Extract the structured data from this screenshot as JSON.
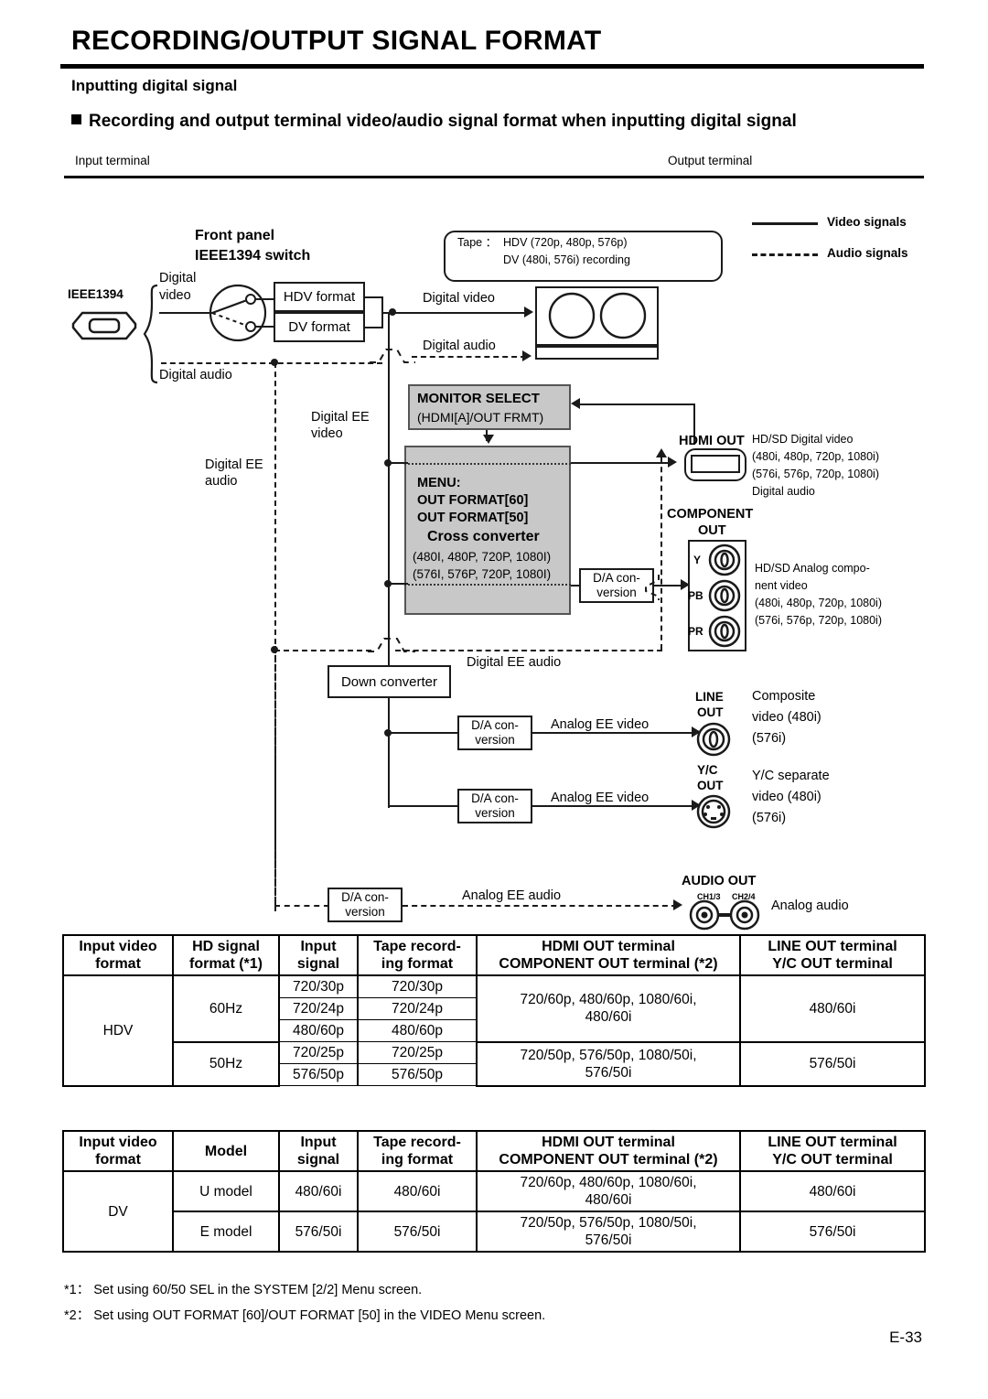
{
  "header": {
    "title": "RECORDING/OUTPUT SIGNAL FORMAT",
    "subtitle": "Inputting digital signal",
    "bullet_heading": "Recording and output terminal video/audio signal format when inputting digital signal",
    "input_terminal_label": "Input terminal",
    "output_terminal_label": "Output terminal"
  },
  "legend": {
    "video": "Video signals",
    "audio": "Audio signals"
  },
  "diagram": {
    "ieee1394_label": "IEEE1394",
    "front_panel_line1": "Front panel",
    "front_panel_line2": "IEEE1394 switch",
    "digital_video": "Digital",
    "digital_video2": "video",
    "digital_audio_in": "Digital audio",
    "hdv_format_box": "HDV format",
    "dv_format_box": "DV format",
    "tape_line1": "Tape ：  HDV (720p, 480p, 576p)",
    "tape_line2": "DV (480i, 576i) recording",
    "digital_video_to_vcr": "Digital video",
    "digital_audio_to_vcr": "Digital audio",
    "digital_ee_video": "Digital EE",
    "digital_ee_video2": "video",
    "digital_ee_audio": "Digital EE",
    "digital_ee_audio2": "audio",
    "monitor_select_line1": "MONITOR SELECT",
    "monitor_select_line2": "(HDMI[A]/OUT FRMT)",
    "menu_line1": "MENU:",
    "menu_line2": "OUT FORMAT[60]",
    "menu_line3": "OUT FORMAT[50]",
    "cross_converter": "Cross converter",
    "cross_line1": "(480I, 480P, 720P, 1080I)",
    "cross_line2": "(576I, 576P, 720P, 1080I)",
    "da_conversion_1": "D/A con-",
    "da_conversion_2": "version",
    "down_converter": "Down converter",
    "digital_ee_audio_mid": "Digital EE audio",
    "analog_ee_video_1": "Analog EE video",
    "analog_ee_video_2": "Analog EE video",
    "analog_ee_audio": "Analog EE audio"
  },
  "terminals": {
    "hdmi_out": "HDMI OUT",
    "hdmi_desc": [
      "HD/SD Digital video",
      "(480i, 480p, 720p, 1080i)",
      "(576i, 576p, 720p, 1080i)",
      "Digital audio"
    ],
    "component_out_line1": "COMPONENT",
    "component_out_line2": "OUT",
    "component_pins": [
      "Y",
      "PB",
      "PR"
    ],
    "component_desc": [
      "HD/SD Analog compo-",
      "nent video",
      "(480i, 480p, 720p, 1080i)",
      "(576i, 576p, 720p, 1080i)"
    ],
    "line_out_line1": "LINE",
    "line_out_line2": "OUT",
    "line_desc": [
      "Composite",
      "video (480i)",
      "(576i)"
    ],
    "yc_out_line1": "Y/C",
    "yc_out_line2": "OUT",
    "yc_desc": [
      "Y/C separate",
      "video (480i)",
      "(576i)"
    ],
    "audio_out": "AUDIO OUT",
    "audio_ch1": "CH1/3",
    "audio_ch2": "CH2/4",
    "audio_desc": "Analog audio"
  },
  "table_hdv": {
    "headers": [
      [
        "Input video",
        "format"
      ],
      [
        "HD signal",
        "format (*1)"
      ],
      [
        "Input",
        "signal"
      ],
      [
        "Tape record-",
        "ing format"
      ],
      [
        "HDMI OUT terminal",
        "COMPONENT OUT terminal (*2)"
      ],
      [
        "LINE OUT terminal",
        "Y/C OUT terminal"
      ]
    ],
    "format": "HDV",
    "groups": [
      {
        "hd_signal": "60Hz",
        "rows": [
          {
            "input": "720/30p",
            "tape": "720/30p"
          },
          {
            "input": "720/24p",
            "tape": "720/24p"
          },
          {
            "input": "480/60p",
            "tape": "480/60p"
          }
        ],
        "hdmi": [
          "720/60p, 480/60p, 1080/60i,",
          "480/60i"
        ],
        "line": "480/60i"
      },
      {
        "hd_signal": "50Hz",
        "rows": [
          {
            "input": "720/25p",
            "tape": "720/25p"
          },
          {
            "input": "576/50p",
            "tape": "576/50p"
          }
        ],
        "hdmi": [
          "720/50p, 576/50p, 1080/50i,",
          "576/50i"
        ],
        "line": "576/50i"
      }
    ]
  },
  "table_dv": {
    "headers": [
      [
        "Input video",
        "format"
      ],
      [
        "Model"
      ],
      [
        "Input",
        "signal"
      ],
      [
        "Tape record-",
        "ing format"
      ],
      [
        "HDMI OUT terminal",
        "COMPONENT OUT terminal (*2)"
      ],
      [
        "LINE OUT terminal",
        "Y/C OUT terminal"
      ]
    ],
    "format": "DV",
    "rows": [
      {
        "model": "U model",
        "input": "480/60i",
        "tape": "480/60i",
        "hdmi": [
          "720/60p, 480/60p, 1080/60i,",
          "480/60i"
        ],
        "line": "480/60i"
      },
      {
        "model": "E model",
        "input": "576/50i",
        "tape": "576/50i",
        "hdmi": [
          "720/50p, 576/50p, 1080/50i,",
          "576/50i"
        ],
        "line": "576/50i"
      }
    ]
  },
  "footnotes": {
    "n1": "*1： Set using 60/50 SEL in the SYSTEM [2/2] Menu screen.",
    "n2": "*2： Set using OUT FORMAT [60]/OUT FORMAT [50] in the VIDEO Menu screen."
  },
  "page_number": "E-33"
}
